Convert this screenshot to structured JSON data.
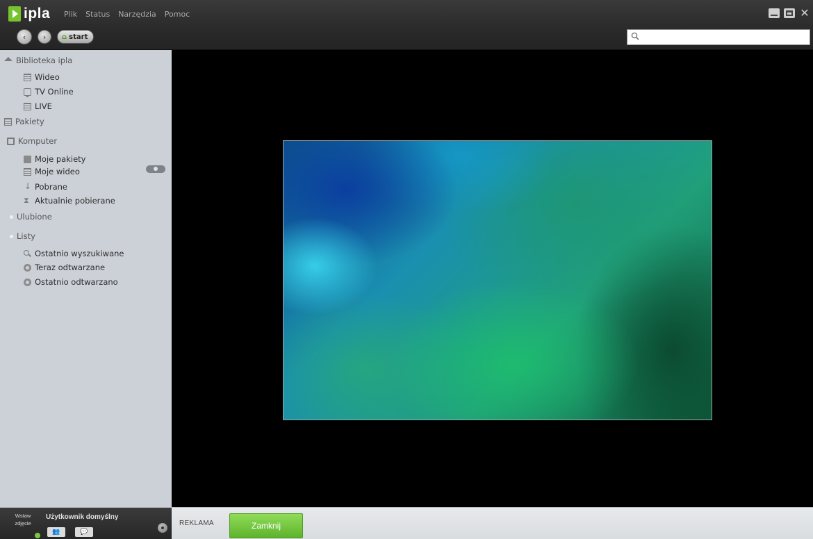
{
  "app": {
    "logo_text": "ipla"
  },
  "menu": [
    "Plik",
    "Status",
    "Narzędzia",
    "Pomoc"
  ],
  "nav": {
    "back_label": "‹",
    "forward_label": "›",
    "start_label": "start"
  },
  "search": {
    "value": "",
    "placeholder": ""
  },
  "sidebar": {
    "biblioteka": "Biblioteka ipla",
    "wideo": "Wideo",
    "tv_online": "TV Online",
    "live": "LIVE",
    "pakiety": "Pakiety",
    "komputer": "Komputer",
    "moje_pakiety": "Moje pakiety",
    "moje_wideo": "Moje wideo",
    "pobrane": "Pobrane",
    "aktualnie_pobierane": "Aktualnie pobierane",
    "ulubione": "Ulubione",
    "listy": "Listy",
    "ostatnio_wyszukiwane": "Ostatnio wyszukiwane",
    "teraz_odtwarzane": "Teraz odtwarzane",
    "ostatnio_odtwarzano": "Ostatnio odtwarzano"
  },
  "bottom": {
    "photo_line1": "Wstaw",
    "photo_line2": "zdjęcie",
    "user_name": "Użytkownik domyślny",
    "reklama": "REKLAMA",
    "close_label": "Zamknij"
  },
  "colors": {
    "accent_green": "#6cc23a",
    "sidebar_bg": "#ccd1d7",
    "frame_dark": "#2e2e2e"
  }
}
